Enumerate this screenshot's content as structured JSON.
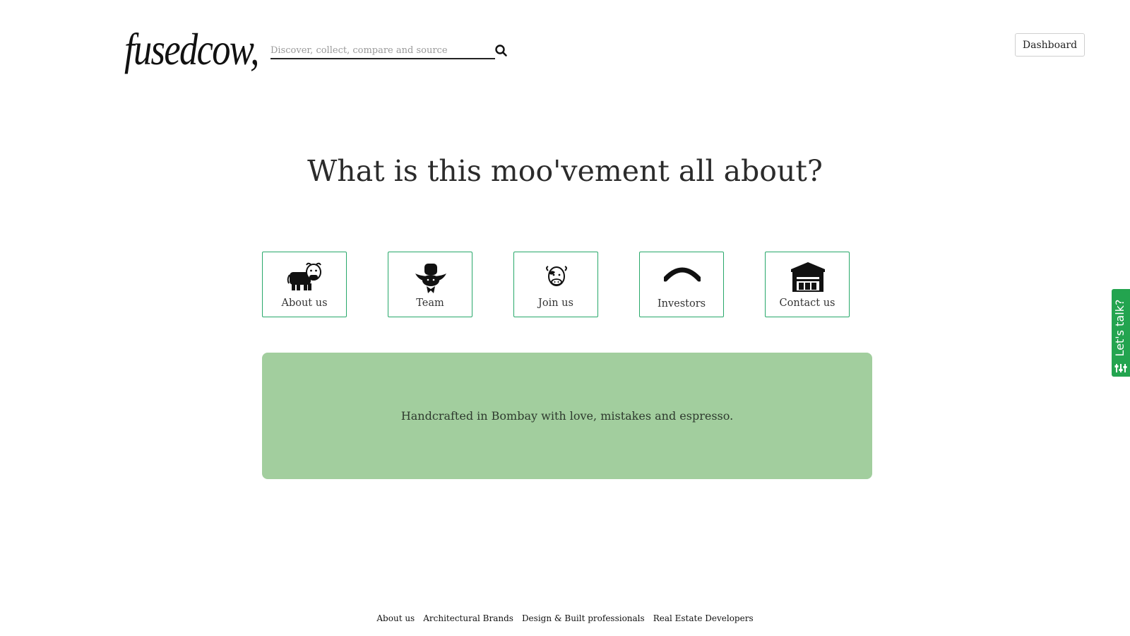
{
  "header": {
    "logo": "fusedcow,",
    "search_placeholder": "Discover, collect, compare and source",
    "search_icon": "search-icon",
    "dashboard_label": "Dashboard"
  },
  "hero": {
    "headline": "What is this moo'vement all about?"
  },
  "tiles": [
    {
      "label": "About us",
      "icon": "cow-icon"
    },
    {
      "label": "Team",
      "icon": "cowboy-icon"
    },
    {
      "label": "Join us",
      "icon": "cow-face-icon"
    },
    {
      "label": "Investors",
      "icon": "arc-icon"
    },
    {
      "label": "Contact us",
      "icon": "barn-icon"
    }
  ],
  "banner": {
    "text": "Handcrafted in Bombay with love, mistakes and espresso."
  },
  "footer": {
    "links": [
      "About us",
      "Architectural Brands",
      "Design & Built professionals",
      "Real Estate Developers"
    ]
  },
  "feedback": {
    "label": "Let's talk?",
    "icon": "sliders-icon",
    "color": "#23a44f"
  },
  "colors": {
    "tile_border": "#28a86a",
    "banner_bg": "#a2ce9e"
  }
}
